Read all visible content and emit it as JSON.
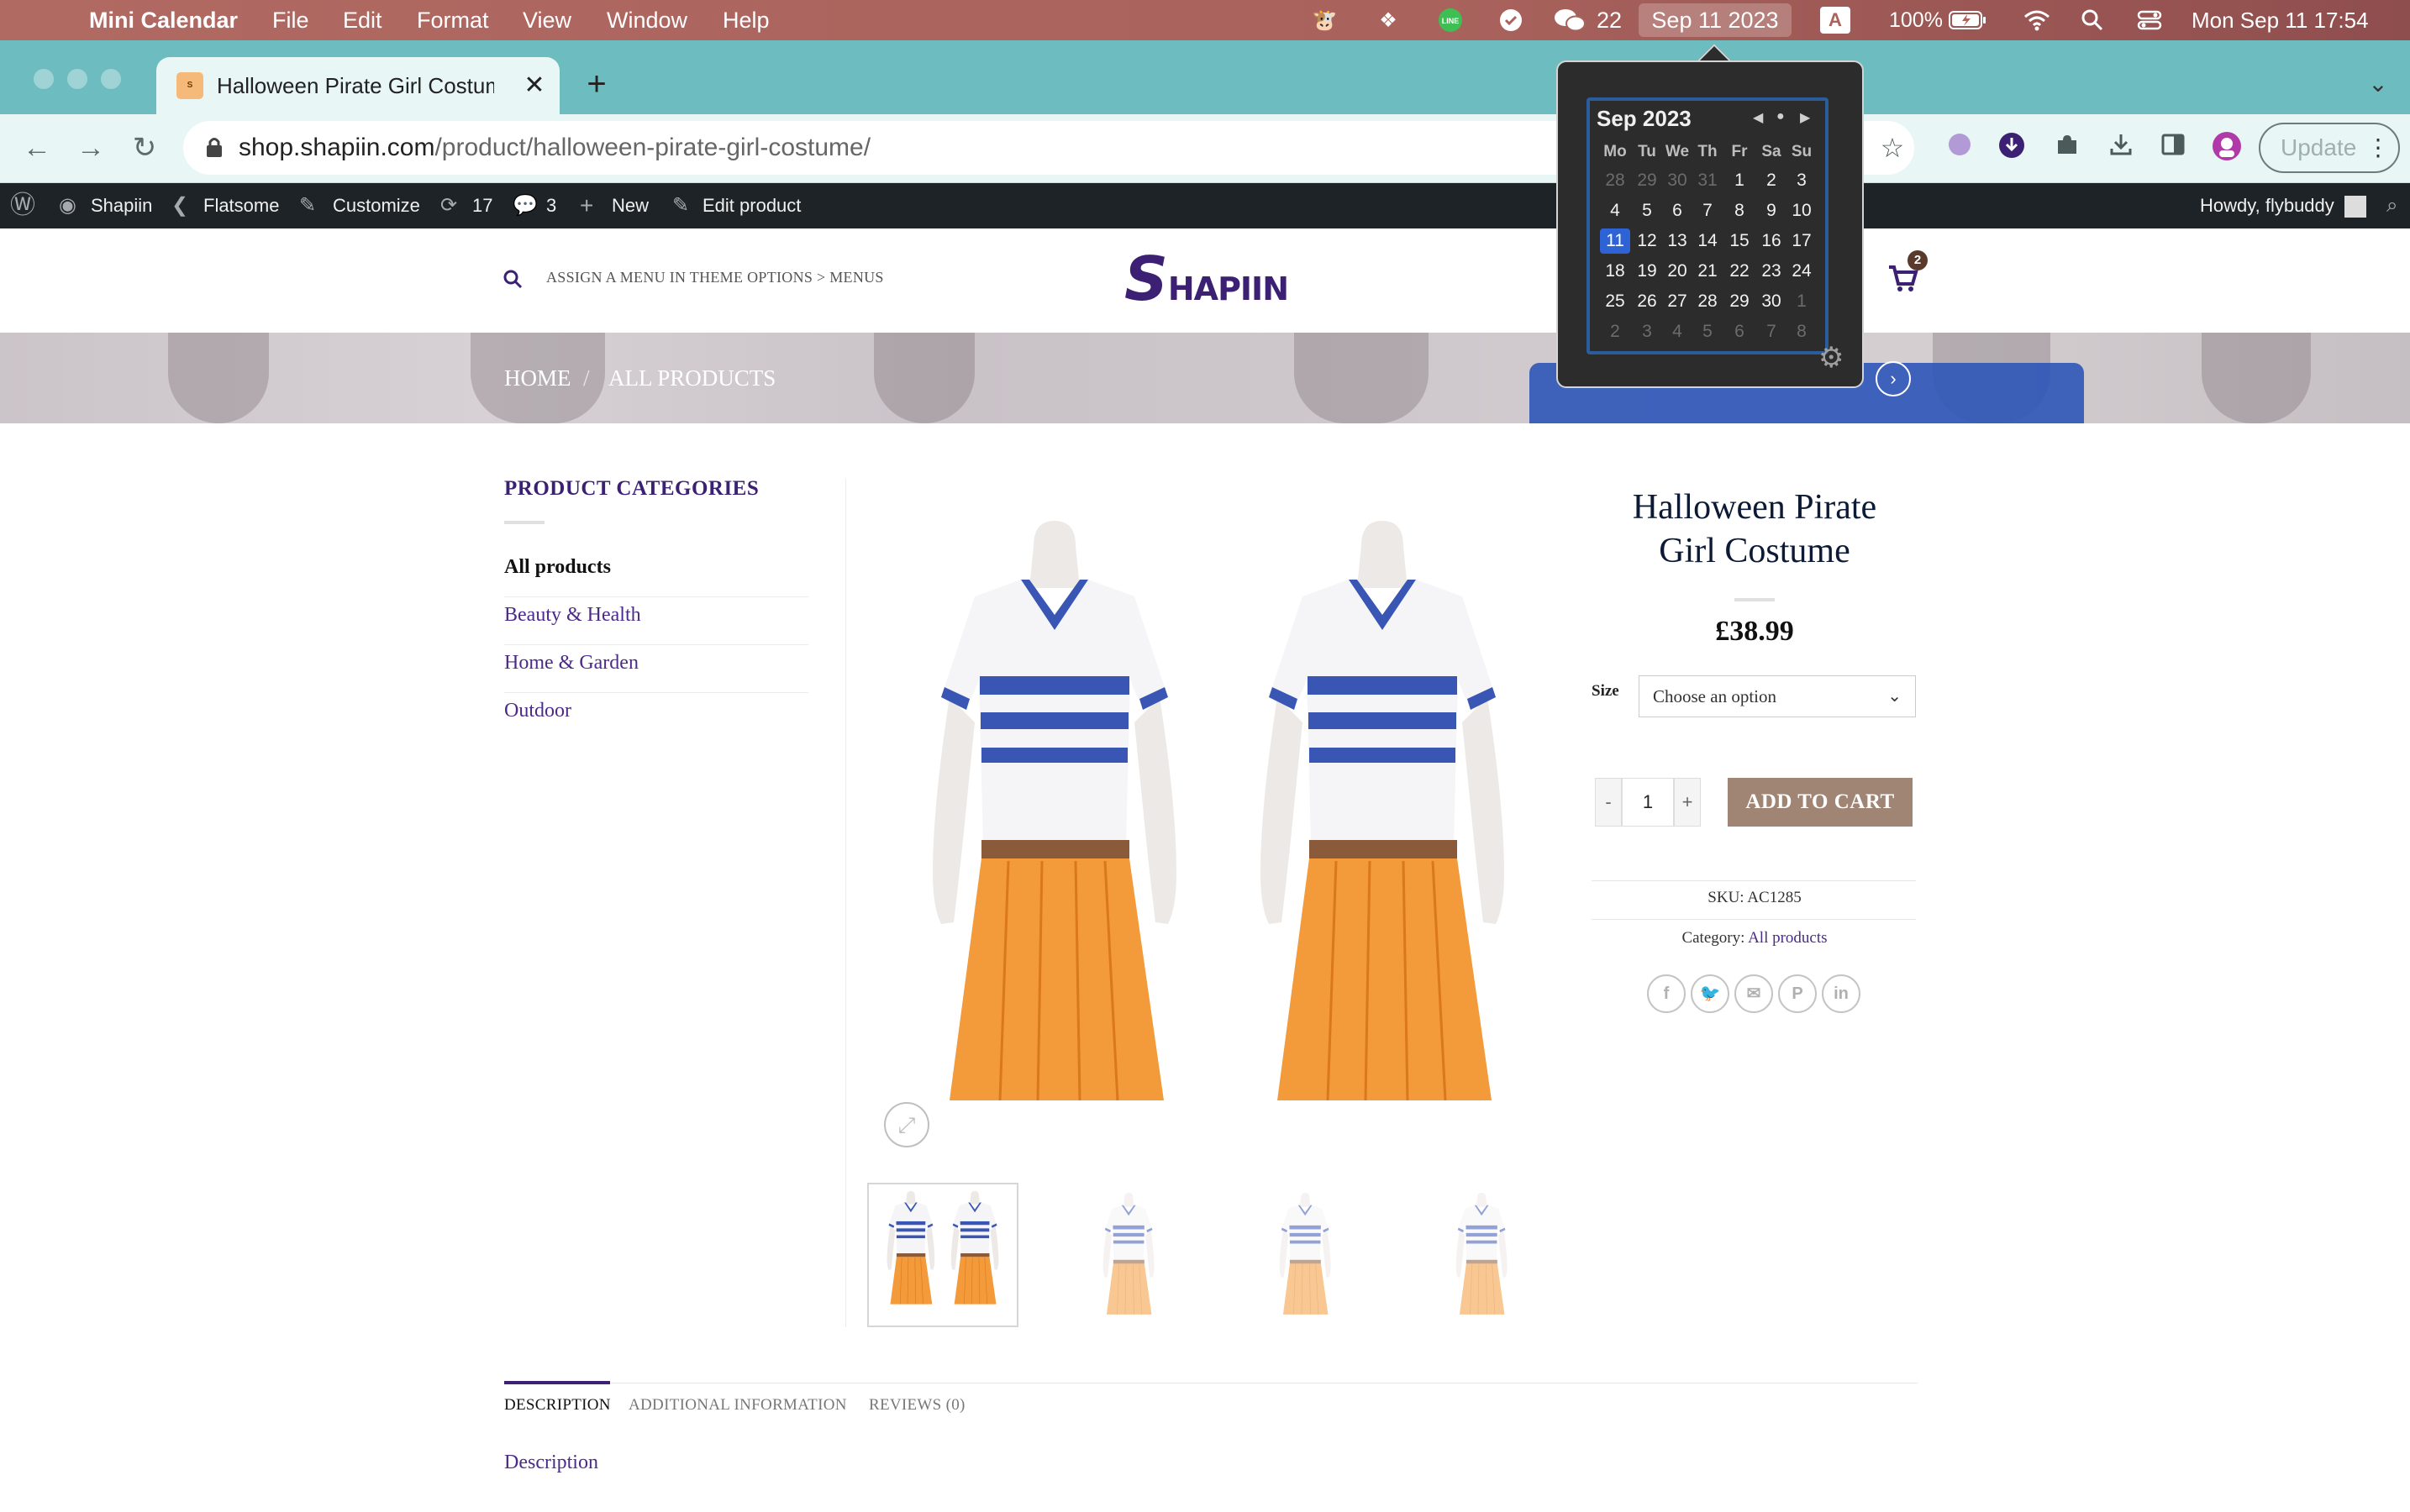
{
  "menubar": {
    "app_name": "Mini Calendar",
    "menus": [
      "File",
      "Edit",
      "Format",
      "View",
      "Window",
      "Help"
    ],
    "badge_count": "22",
    "date_widget": "Sep 11 2023",
    "input_source": "A",
    "battery": "100%",
    "clock": "Mon Sep 11  17:54"
  },
  "browser": {
    "tab_title": "Halloween Pirate Girl Costume",
    "url_host": "shop.shapiin.com",
    "url_path": "/product/halloween-pirate-girl-costume/",
    "update_label": "Update"
  },
  "wp_admin": {
    "site_name": "Shapiin",
    "theme": "Flatsome",
    "customize": "Customize",
    "updates_count": "17",
    "comments_count": "3",
    "new_label": "New",
    "edit_label": "Edit product",
    "howdy": "Howdy, flybuddy"
  },
  "header": {
    "menu_hint": "ASSIGN A MENU IN THEME OPTIONS > MENUS",
    "logo_initial": "S",
    "logo_rest": "HAPIIN",
    "cart_count": "2"
  },
  "breadcrumb": {
    "home": "HOME",
    "sep": "/",
    "current": "ALL PRODUCTS"
  },
  "sidebar": {
    "title": "PRODUCT CATEGORIES",
    "categories": [
      "All products",
      "Beauty & Health",
      "Home & Garden",
      "Outdoor"
    ]
  },
  "product": {
    "title_line1": "Halloween Pirate",
    "title_line2": "Girl Costume",
    "price": "£38.99",
    "size_label": "Size",
    "size_placeholder": "Choose an option",
    "quantity": "1",
    "minus": "-",
    "plus": "+",
    "add_to_cart": "ADD TO CART",
    "sku_label": "SKU:",
    "sku": "AC1285",
    "category_label": "Category:",
    "category": "All products"
  },
  "tabs": [
    "DESCRIPTION",
    "ADDITIONAL INFORMATION",
    "REVIEWS (0)"
  ],
  "description_heading": "Description",
  "calendar": {
    "title": "Sep 2023",
    "weekdays": [
      "Mo",
      "Tu",
      "We",
      "Th",
      "Fr",
      "Sa",
      "Su"
    ],
    "weeks": [
      [
        "28",
        "29",
        "30",
        "31",
        "1",
        "2",
        "3"
      ],
      [
        "4",
        "5",
        "6",
        "7",
        "8",
        "9",
        "10"
      ],
      [
        "11",
        "12",
        "13",
        "14",
        "15",
        "16",
        "17"
      ],
      [
        "18",
        "19",
        "20",
        "21",
        "22",
        "23",
        "24"
      ],
      [
        "25",
        "26",
        "27",
        "28",
        "29",
        "30",
        "1"
      ],
      [
        "2",
        "3",
        "4",
        "5",
        "6",
        "7",
        "8"
      ]
    ],
    "today": "11"
  },
  "colors": {
    "brand_purple": "#3b2073",
    "link_purple": "#4c2a8a",
    "cart_button": "#a08575",
    "tab_teal": "#6dbcc0",
    "calendar_highlight": "#2e63d6"
  }
}
